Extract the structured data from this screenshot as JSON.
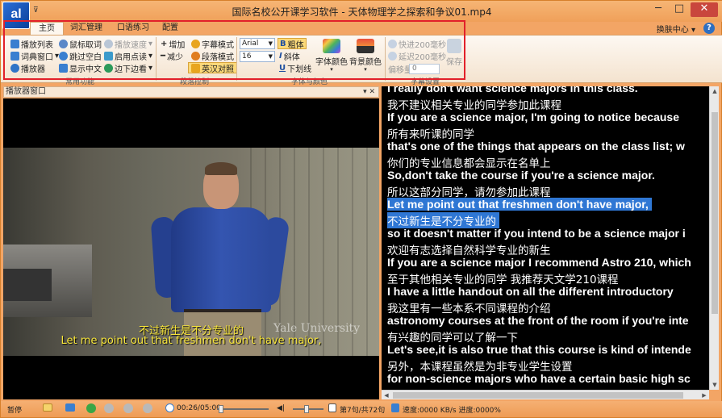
{
  "window": {
    "title": "国际名校公开课学习软件 - 天体物理学之探索和争议01.mp4",
    "logo_text": "al",
    "menu_glyph": "⊽",
    "minimize": "─",
    "maximize": "□",
    "close": "✕"
  },
  "tabs": [
    "主页",
    "词汇管理",
    "口语练习",
    "配置"
  ],
  "switch_center": "换肤中心",
  "ribbon": {
    "group1": {
      "items": [
        "播放列表",
        "词典窗口",
        "播放器"
      ],
      "dropdown_glyph": "▾",
      "label": "常用功能"
    },
    "group2": {
      "items": [
        "鼠标取词",
        "跳过空白",
        "显示中文",
        "播放速度",
        "启用点读",
        "边下边看"
      ]
    },
    "group3": {
      "items": [
        "增加",
        "字幕模式",
        "减少",
        "段落模式",
        "英汉对照"
      ],
      "label": "段落控制"
    },
    "group4": {
      "font_name": "Arial",
      "font_size": "16",
      "bold": "粗体",
      "italic": "斜体",
      "underline": "下划线",
      "font_color": "字体颜色",
      "bg_color": "背景颜色",
      "label": "字体与颜色"
    },
    "group5": {
      "fast": "快进200毫秒",
      "delay": "延迟200毫秒",
      "offset_label": "偏移量",
      "offset_value": "0",
      "save": "保存",
      "label": "字幕设置"
    }
  },
  "player": {
    "header": "播放器窗口",
    "pin": "▾ ✕",
    "subtitle_cn": "不过新生是不分专业的",
    "subtitle_en": "Let me point out that freshmen don't have major,",
    "watermark": "Yale University"
  },
  "transcript": {
    "lines": [
      {
        "text": "I really don't want science majors in this class.",
        "lang": "en"
      },
      {
        "text": "我不建议相关专业的同学参加此课程",
        "lang": "cn"
      },
      {
        "text": "If you are a science major, I'm going to notice because",
        "lang": "en"
      },
      {
        "text": "所有来听课的同学",
        "lang": "cn"
      },
      {
        "text": "that's one of the things that appears on the class list; w",
        "lang": "en"
      },
      {
        "text": "你们的专业信息都会显示在名单上",
        "lang": "cn"
      },
      {
        "text": "So,don't take the course if you're a science major.",
        "lang": "en"
      },
      {
        "text": "所以这部分同学，请勿参加此课程",
        "lang": "cn"
      },
      {
        "text": "Let me point out that freshmen don't have major,",
        "lang": "en",
        "highlight": true
      },
      {
        "text": "不过新生是不分专业的",
        "lang": "cn",
        "highlight": true
      },
      {
        "text": "so it doesn't matter if you intend to be a science major i",
        "lang": "en"
      },
      {
        "text": "欢迎有志选择自然科学专业的新生",
        "lang": "cn"
      },
      {
        "text": "If you are a science major I recommend Astro 210, which",
        "lang": "en"
      },
      {
        "text": "至于其他相关专业的同学 我推荐天文学210课程",
        "lang": "cn"
      },
      {
        "text": "I have a little handout on all the different introductory",
        "lang": "en"
      },
      {
        "text": "我这里有一些本系不同课程的介绍",
        "lang": "cn"
      },
      {
        "text": "astronomy courses at the front of the room if you're inte",
        "lang": "en"
      },
      {
        "text": "有兴趣的同学可以了解一下",
        "lang": "cn"
      },
      {
        "text": "Let's see,it is also true that this course is kind of intende",
        "lang": "en"
      },
      {
        "text": "另外，本课程虽然是为非专业学生设置",
        "lang": "cn"
      },
      {
        "text": "for non-science majors who have a certain basic high sc",
        "lang": "en"
      }
    ]
  },
  "statusbar": {
    "state": "暂停",
    "time": "00:26/05:00",
    "sentence": "第7句/共72句",
    "speed": "速度:0000 KB/s 进度:0000%"
  },
  "colors": {
    "highlight": "#2f77d4",
    "subtitle": "#f6e43a",
    "accent": "#f0a059"
  }
}
